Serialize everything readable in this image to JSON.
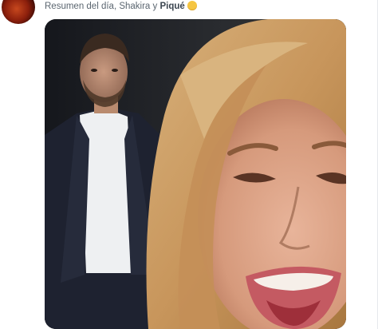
{
  "post": {
    "text_prefix": "Resumen del día, Shakira y ",
    "text_bold": "Piqué",
    "emoji_icon": "smirk-emoji-icon"
  },
  "media": {
    "type": "photo",
    "icon": "photo-thumbnail"
  },
  "colors": {
    "text": "#5b6670",
    "background": "#ffffff",
    "card_border": "#e6e9ec"
  }
}
